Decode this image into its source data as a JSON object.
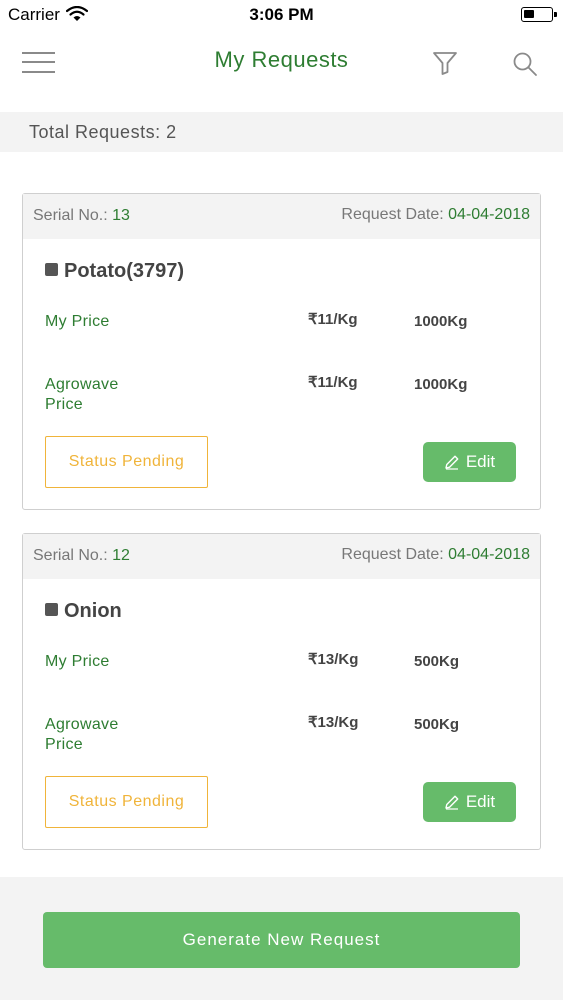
{
  "status_bar": {
    "carrier": "Carrier",
    "time": "3:06 PM"
  },
  "nav": {
    "title": "My Requests"
  },
  "summary": {
    "total_label": "Total Requests: 2"
  },
  "requests": [
    {
      "serial_label": "Serial No.:",
      "serial": "13",
      "date_label": "Request Date:",
      "date": "04-04-2018",
      "product": "Potato(3797)",
      "my_price_label": "My Price",
      "my_price": "₹11/Kg",
      "my_qty": "1000Kg",
      "agro_label_1": "Agrowave",
      "agro_label_2": "Price",
      "agro_price": "₹11/Kg",
      "agro_qty": "1000Kg",
      "status": "Status Pending",
      "edit_label": "Edit"
    },
    {
      "serial_label": "Serial No.:",
      "serial": "12",
      "date_label": "Request Date:",
      "date": "04-04-2018",
      "product": "Onion",
      "my_price_label": "My Price",
      "my_price": "₹13/Kg",
      "my_qty": "500Kg",
      "agro_label_1": "Agrowave",
      "agro_label_2": "Price",
      "agro_price": "₹13/Kg",
      "agro_qty": "500Kg",
      "status": "Status Pending",
      "edit_label": "Edit"
    }
  ],
  "footer": {
    "generate_label": "Generate New Request"
  },
  "colors": {
    "primary_green": "#2e7d32",
    "button_green": "#66bb6a",
    "pending_orange": "#f0b43a",
    "bar_gray": "#f3f3f3"
  },
  "icons": [
    "wifi-icon",
    "battery-icon",
    "menu-icon",
    "filter-icon",
    "search-icon",
    "pencil-icon"
  ]
}
